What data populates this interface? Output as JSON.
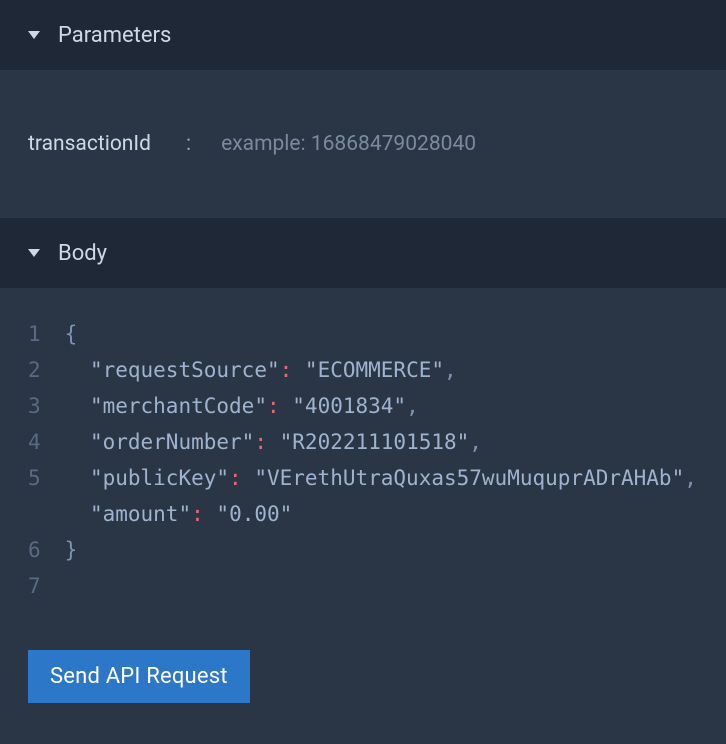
{
  "sections": {
    "parameters": {
      "title": "Parameters",
      "items": [
        {
          "name": "transactionId",
          "placeholder": "example: 16868479028040",
          "value": ""
        }
      ]
    },
    "body": {
      "title": "Body",
      "json": {
        "requestSource": "ECOMMERCE",
        "merchantCode": "4001834",
        "orderNumber": "R202211101518",
        "publicKey": "VErethUtraQuxas57wuMuquprADrAHAb",
        "amount": "0.00"
      }
    }
  },
  "actions": {
    "send_label": "Send API Request"
  },
  "colors": {
    "bg_dark": "#1e2836",
    "bg_panel": "#2a3545",
    "accent": "#2d77c8",
    "colon": "#e06c75"
  }
}
